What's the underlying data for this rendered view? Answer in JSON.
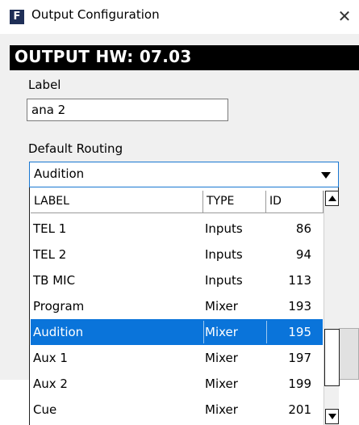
{
  "window": {
    "title": "Output Configuration",
    "icon_letter": "F",
    "close_glyph": "✕"
  },
  "banner": {
    "text": "OUTPUT HW: 07.03"
  },
  "label_field": {
    "label": "Label",
    "value": "ana 2"
  },
  "routing": {
    "label": "Default Routing",
    "selected": "Audition",
    "columns": [
      "LABEL",
      "TYPE",
      "ID"
    ],
    "options": [
      {
        "label": "TEL 1",
        "type": "Inputs",
        "id": "86"
      },
      {
        "label": "TEL 2",
        "type": "Inputs",
        "id": "94"
      },
      {
        "label": "TB MIC",
        "type": "Inputs",
        "id": "113"
      },
      {
        "label": "Program",
        "type": "Mixer",
        "id": "193"
      },
      {
        "label": "Audition",
        "type": "Mixer",
        "id": "195"
      },
      {
        "label": "Aux 1",
        "type": "Mixer",
        "id": "197"
      },
      {
        "label": "Aux 2",
        "type": "Mixer",
        "id": "199"
      },
      {
        "label": "Cue",
        "type": "Mixer",
        "id": "201"
      }
    ]
  },
  "colors": {
    "selection": "#0a74da",
    "focus_border": "#1877d1",
    "banner_bg": "#000000",
    "app_icon_bg": "#1f2f57"
  }
}
